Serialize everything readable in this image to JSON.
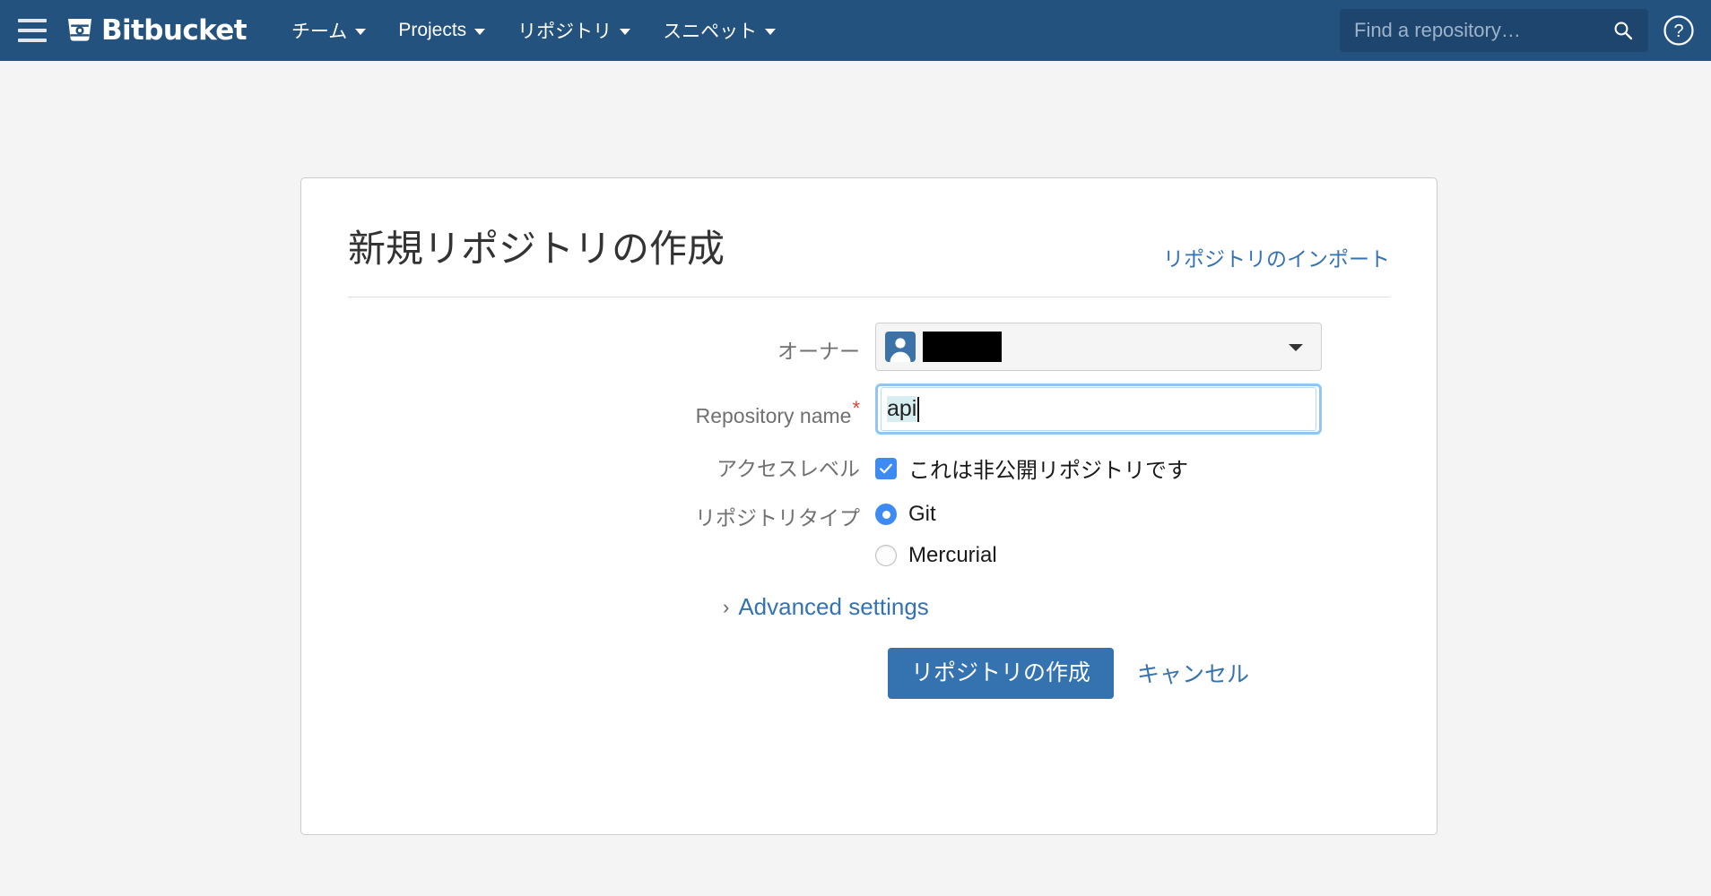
{
  "navbar": {
    "menu_icon": "hamburger-icon",
    "brand": "Bitbucket",
    "items": [
      {
        "label": "チーム",
        "has_caret": true
      },
      {
        "label": "Projects",
        "has_caret": true
      },
      {
        "label": "リポジトリ",
        "has_caret": true
      },
      {
        "label": "スニペット",
        "has_caret": true
      }
    ],
    "search": {
      "placeholder": "Find a repository…",
      "icon": "search-icon"
    },
    "help": {
      "icon": "help-circle-icon",
      "label": "?"
    },
    "background_color": "#24527f",
    "search_background_color": "#1d456e"
  },
  "card": {
    "title": "新規リポジトリの作成",
    "import_link": "リポジトリのインポート",
    "form": {
      "owner": {
        "label": "オーナー",
        "avatar_icon": "user-avatar-icon",
        "value": "",
        "redacted": true,
        "caret_icon": "chevron-down-icon"
      },
      "repository_name": {
        "label": "Repository name",
        "required_marker": "*",
        "value": "api",
        "focused": true,
        "highlight_color": "#d9eef1",
        "focus_ring_color": "#92c5f2"
      },
      "access_level": {
        "label": "アクセスレベル",
        "checkbox_label": "これは非公開リポジトリです",
        "checked": true,
        "checkbox_color": "#3d8bf2"
      },
      "repository_type": {
        "label": "リポジトリタイプ",
        "options": [
          {
            "label": "Git",
            "selected": true
          },
          {
            "label": "Mercurial",
            "selected": false
          }
        ],
        "radio_color": "#3d8bf2"
      },
      "advanced_settings": {
        "label": "Advanced settings",
        "chevron": "›",
        "expanded": false
      },
      "actions": {
        "submit_label": "リポジトリの作成",
        "cancel_label": "キャンセル",
        "submit_color": "#3572b0",
        "link_color": "#3572b0"
      }
    }
  },
  "colors": {
    "page_background": "#f4f4f4",
    "card_background": "#ffffff",
    "card_border": "#cccccc",
    "label_text": "#707070",
    "link": "#3572b0",
    "required": "#d04437"
  }
}
